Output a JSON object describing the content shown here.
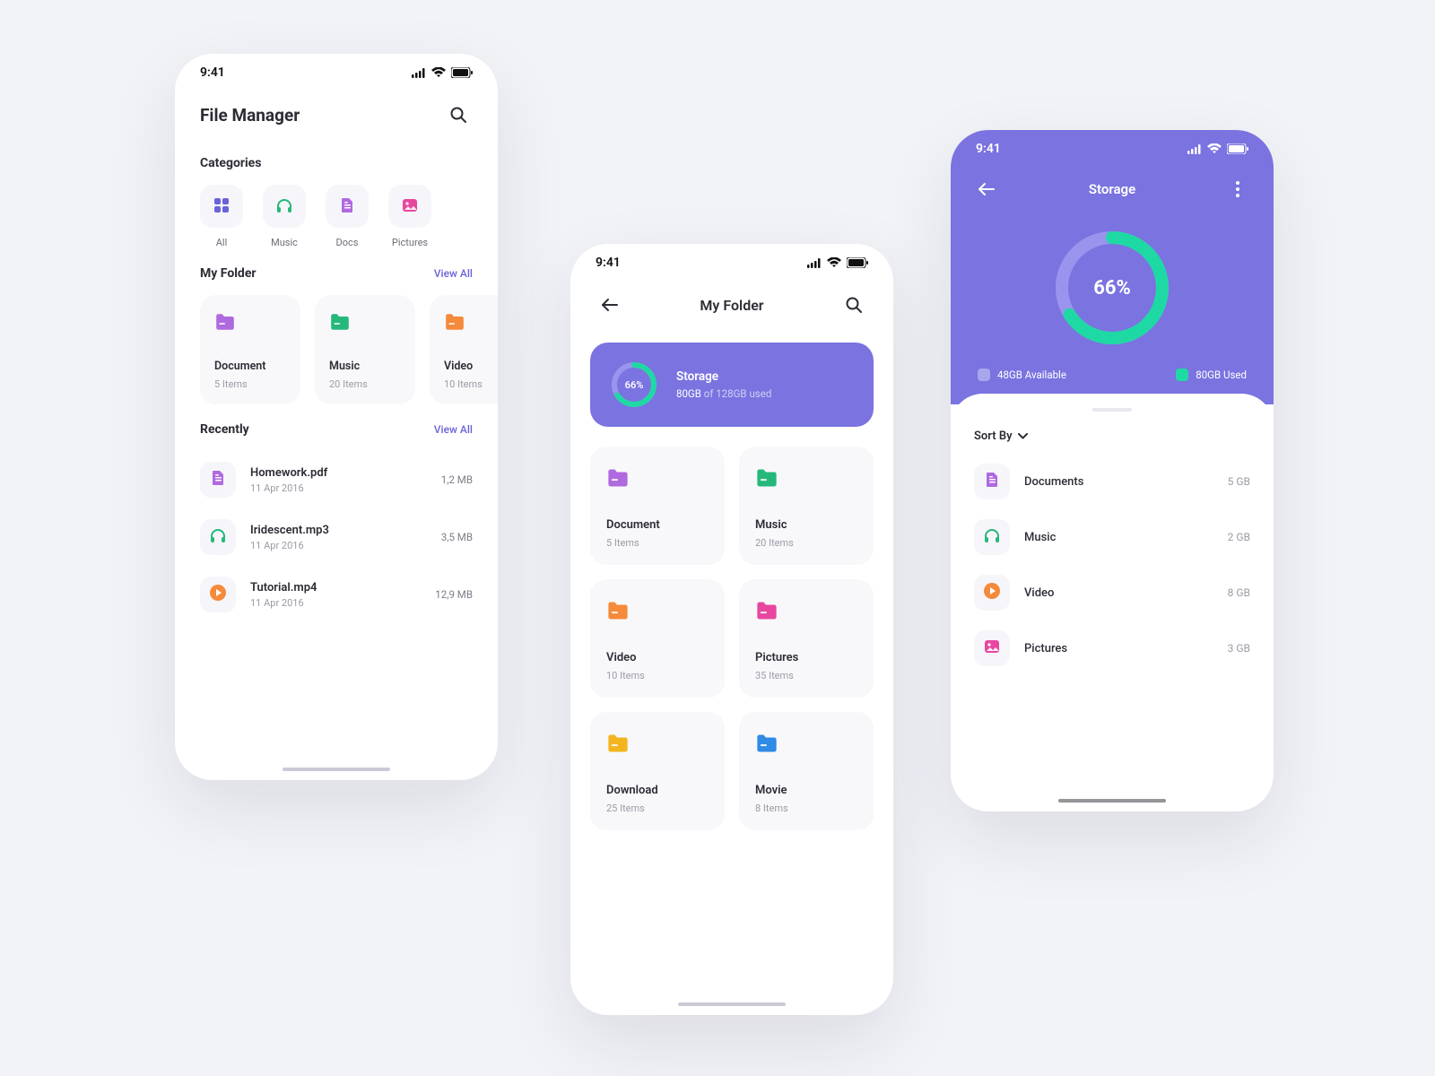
{
  "status": {
    "time": "9:41"
  },
  "colors": {
    "accent": "#7a73e0",
    "mint": "#1fd9a4",
    "purple": "#b06ae0",
    "green": "#25b87a",
    "orange": "#f58a3a",
    "pink": "#e8479f",
    "gold": "#f3b41f",
    "blue": "#2f8be4"
  },
  "screen1": {
    "title": "File Manager",
    "categories_label": "Categories",
    "categories": [
      {
        "name": "All",
        "icon": "grid",
        "color": "#6a63d9"
      },
      {
        "name": "Music",
        "icon": "headphones",
        "color": "#25b87a"
      },
      {
        "name": "Docs",
        "icon": "doc",
        "color": "#b06ae0"
      },
      {
        "name": "Pictures",
        "icon": "picture",
        "color": "#e8479f"
      }
    ],
    "myfolder_label": "My Folder",
    "view_all": "View All",
    "folders": [
      {
        "name": "Document",
        "items": "5 Items",
        "color": "#b06ae0"
      },
      {
        "name": "Music",
        "items": "20 Items",
        "color": "#25b87a"
      },
      {
        "name": "Video",
        "items": "10 Items",
        "color": "#f58a3a"
      }
    ],
    "recently_label": "Recently",
    "recent": [
      {
        "name": "Homework.pdf",
        "date": "11 Apr 2016",
        "size": "1,2 MB",
        "icon": "doc",
        "color": "#b06ae0"
      },
      {
        "name": "Iridescent.mp3",
        "date": "11 Apr 2016",
        "size": "3,5 MB",
        "icon": "headphones",
        "color": "#25b87a"
      },
      {
        "name": "Tutorial.mp4",
        "date": "11 Apr 2016",
        "size": "12,9 MB",
        "icon": "play",
        "color": "#f58a3a"
      }
    ]
  },
  "screen2": {
    "title": "My Folder",
    "storage": {
      "percent": 66,
      "percent_label": "66%",
      "title": "Storage",
      "used": "80GB",
      "of_total": " of 128GB used"
    },
    "folders": [
      {
        "name": "Document",
        "items": "5 Items",
        "color": "#b06ae0"
      },
      {
        "name": "Music",
        "items": "20 Items",
        "color": "#25b87a"
      },
      {
        "name": "Video",
        "items": "10 Items",
        "color": "#f58a3a"
      },
      {
        "name": "Pictures",
        "items": "35 Items",
        "color": "#e8479f"
      },
      {
        "name": "Download",
        "items": "25 Items",
        "color": "#f3b41f"
      },
      {
        "name": "Movie",
        "items": "8 Items",
        "color": "#2f8be4"
      }
    ]
  },
  "screen3": {
    "title": "Storage",
    "percent": 66,
    "percent_label": "66%",
    "legend": {
      "available": "48GB Available",
      "used": "80GB Used"
    },
    "sort_label": "Sort By",
    "items": [
      {
        "name": "Documents",
        "size": "5 GB",
        "icon": "doc",
        "color": "#b06ae0"
      },
      {
        "name": "Music",
        "size": "2 GB",
        "icon": "headphones",
        "color": "#25b87a"
      },
      {
        "name": "Video",
        "size": "8 GB",
        "icon": "play",
        "color": "#f58a3a"
      },
      {
        "name": "Pictures",
        "size": "3 GB",
        "icon": "picture",
        "color": "#e8479f"
      }
    ]
  }
}
